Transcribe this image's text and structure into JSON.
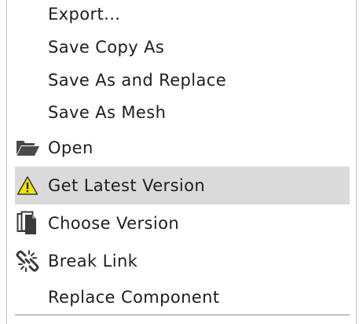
{
  "menu": {
    "items": [
      {
        "label": "Export...",
        "icon": ""
      },
      {
        "label": "Save Copy As",
        "icon": ""
      },
      {
        "label": "Save As and Replace",
        "icon": ""
      },
      {
        "label": "Save As Mesh",
        "icon": ""
      },
      {
        "label": "Open",
        "icon": "folder-open-icon"
      },
      {
        "label": "Get Latest Version",
        "icon": "warning-icon",
        "highlighted": true
      },
      {
        "label": "Choose Version",
        "icon": "versions-icon"
      },
      {
        "label": "Break Link",
        "icon": "broken-link-icon"
      },
      {
        "label": "Replace Component",
        "icon": ""
      }
    ]
  },
  "colors": {
    "highlight": "#dadada",
    "warning_yellow": "#f2e600",
    "text": "#1e1e1e"
  }
}
